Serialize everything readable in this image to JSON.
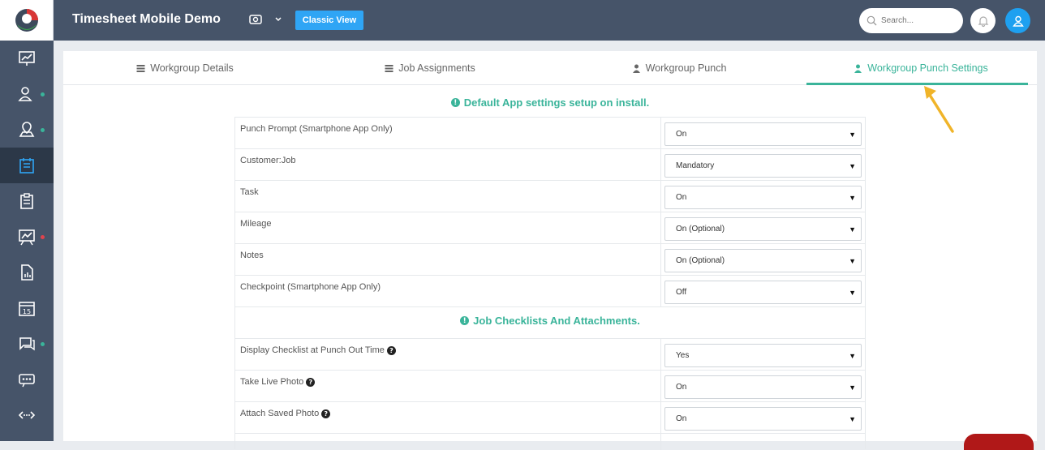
{
  "app": {
    "title": "Timesheet Mobile Demo",
    "classic_view_label": "Classic View"
  },
  "search": {
    "placeholder": "Search..."
  },
  "tabs": [
    {
      "label": "Workgroup Details",
      "icon": "list-icon"
    },
    {
      "label": "Job Assignments",
      "icon": "list-icon"
    },
    {
      "label": "Workgroup Punch",
      "icon": "user-icon"
    },
    {
      "label": "Workgroup Punch Settings",
      "icon": "user-icon",
      "active": true
    }
  ],
  "sections": {
    "default_title": "Default App settings setup on install.",
    "checklist_title": "Job Checklists And Attachments."
  },
  "settings": [
    {
      "label": "Punch Prompt (Smartphone App Only)",
      "value": "On"
    },
    {
      "label": "Customer:Job",
      "value": "Mandatory"
    },
    {
      "label": "Task",
      "value": "On"
    },
    {
      "label": "Mileage",
      "value": "On (Optional)"
    },
    {
      "label": "Notes",
      "value": "On (Optional)"
    },
    {
      "label": "Checkpoint (Smartphone App Only)",
      "value": "Off"
    }
  ],
  "checklist_settings": [
    {
      "label": "Display Checklist at Punch Out Time",
      "value": "Yes",
      "help": true
    },
    {
      "label": "Take Live Photo",
      "value": "On",
      "help": true
    },
    {
      "label": "Attach Saved Photo",
      "value": "On",
      "help": true
    }
  ],
  "colors": {
    "sidebar": "#465469",
    "accent": "#3ab49a",
    "button": "#2fa5f5"
  }
}
